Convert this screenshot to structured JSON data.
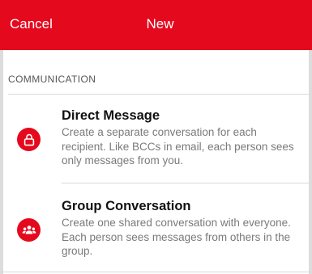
{
  "header": {
    "cancel_label": "Cancel",
    "title": "New"
  },
  "section": {
    "label": "COMMUNICATION"
  },
  "options": [
    {
      "icon": "lock-icon",
      "title": "Direct Message",
      "description": "Create a separate conversation for each recipient. Like BCCs in email, each person sees only messages from you."
    },
    {
      "icon": "people-icon",
      "title": "Group Conversation",
      "description": "Create one shared conversation with everyone. Each person sees messages from others in the group."
    }
  ],
  "colors": {
    "accent": "#e5091e",
    "background": "#ffffff",
    "secondary_text": "#7a7a7a"
  }
}
